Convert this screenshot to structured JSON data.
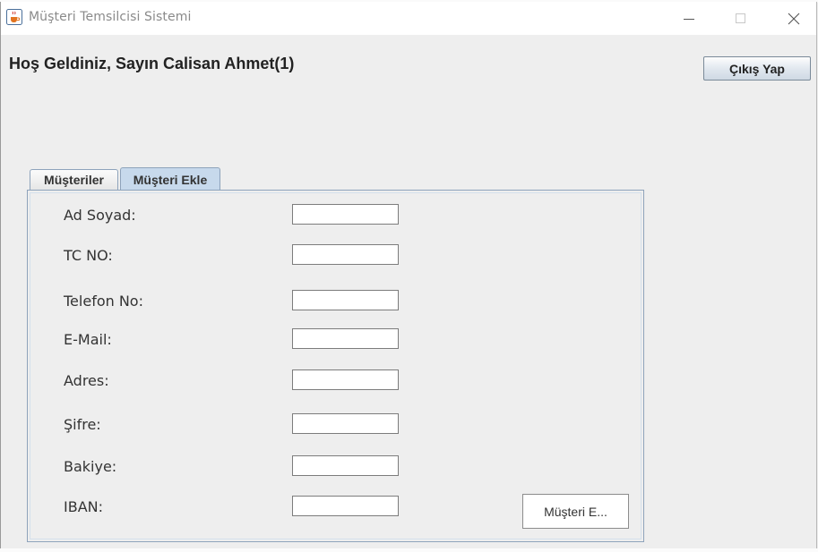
{
  "window": {
    "title": "Müşteri Temsilcisi Sistemi",
    "icon": "java-coffee-cup-icon",
    "controls": [
      "minimize-icon",
      "maximize-icon",
      "close-icon"
    ]
  },
  "header": {
    "welcome_text": "Hoş Geldiniz, Sayın Calisan Ahmet(1)",
    "logout_label": "Çıkış Yap"
  },
  "tabs": [
    {
      "label": "Müşteriler",
      "selected": false
    },
    {
      "label": "Müşteri Ekle",
      "selected": true
    }
  ],
  "form": {
    "fields": [
      {
        "label": "Ad Soyad:",
        "value": ""
      },
      {
        "label": "TC NO:",
        "value": ""
      },
      {
        "label": "Telefon No:",
        "value": ""
      },
      {
        "label": "E-Mail:",
        "value": ""
      },
      {
        "label": "Adres:",
        "value": ""
      },
      {
        "label": "Şifre:",
        "value": ""
      },
      {
        "label": "Bakiye:",
        "value": ""
      },
      {
        "label": "IBAN:",
        "value": ""
      }
    ],
    "submit_label": "Müşteri E..."
  },
  "colors": {
    "selected_tab": "#c7d9ec",
    "tab_border": "#8ea3bb",
    "window_bg": "#eeeeee"
  }
}
